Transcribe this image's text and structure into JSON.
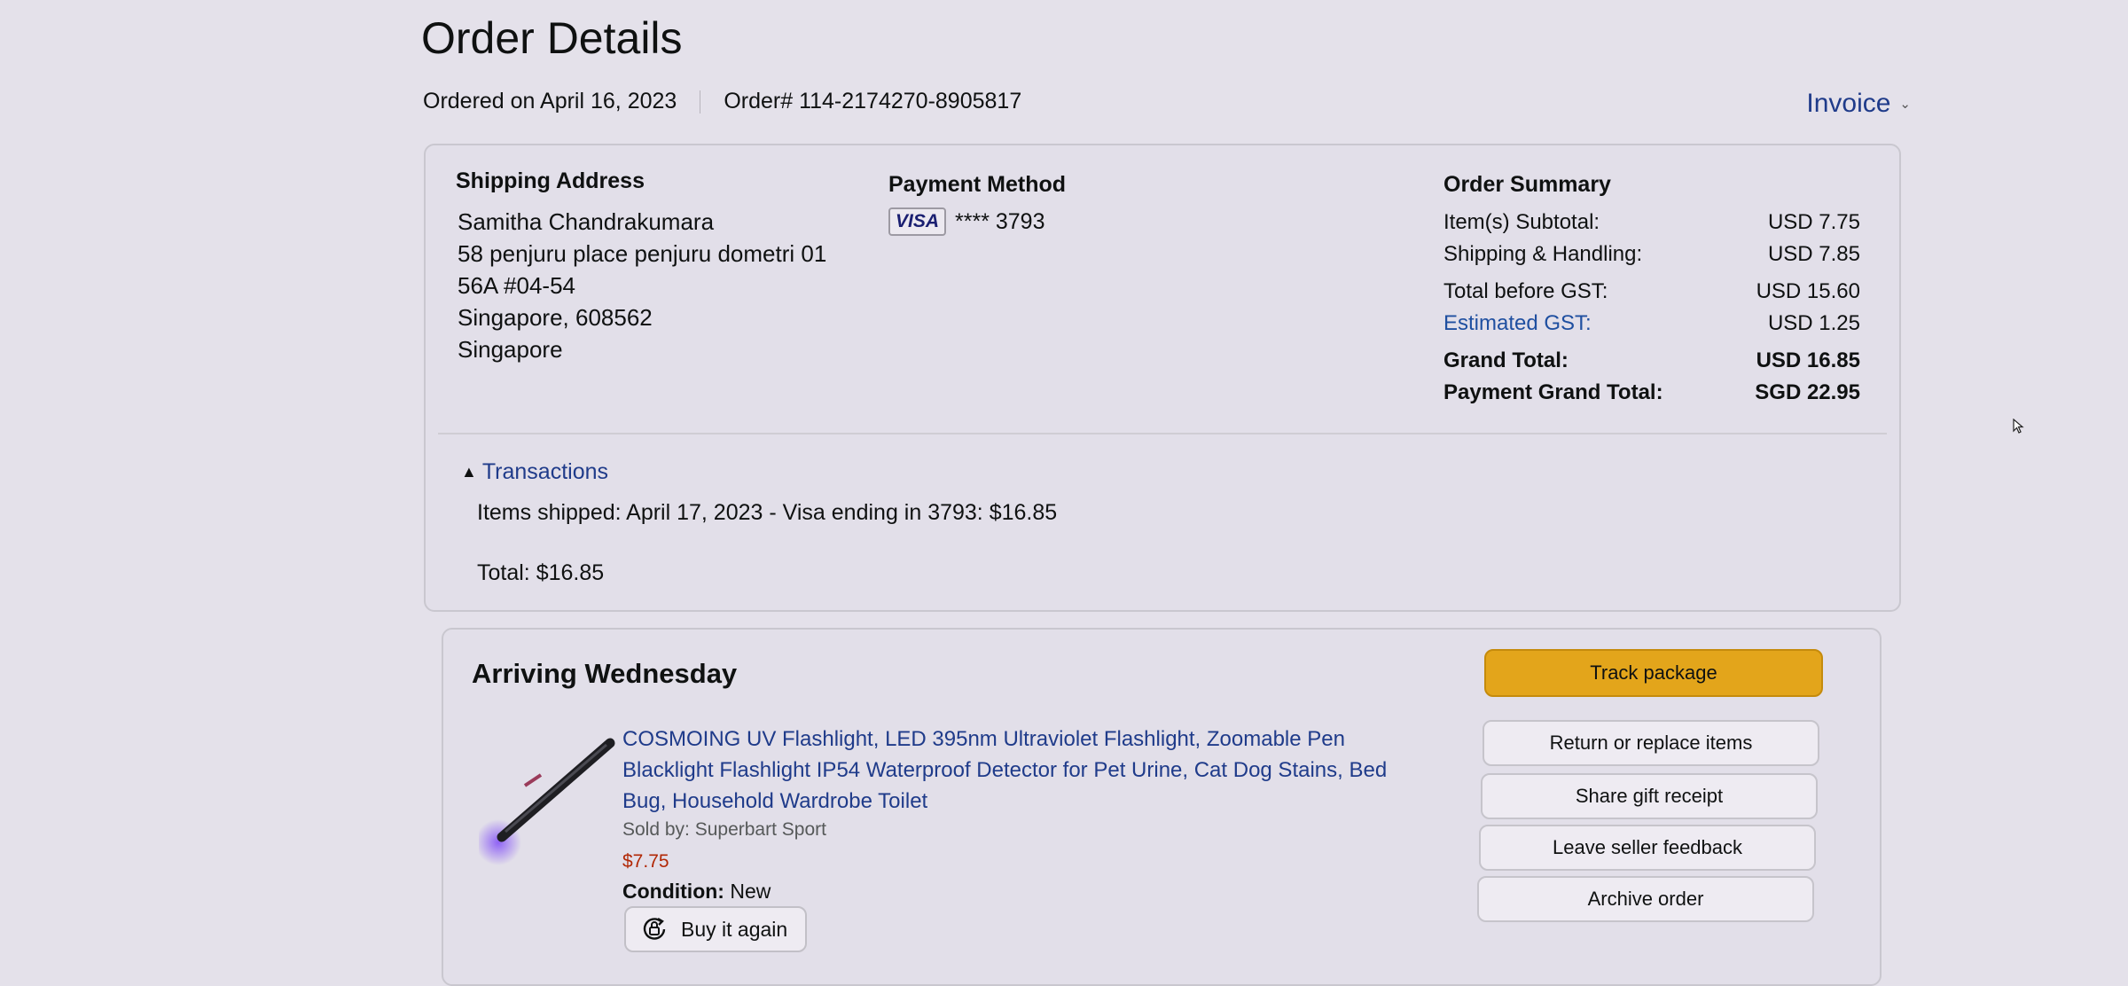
{
  "header": {
    "title": "Order Details",
    "ordered_on": "Ordered on April 16, 2023",
    "order_number": "Order# 114-2174270-8905817",
    "invoice_label": "Invoice"
  },
  "shipping": {
    "label": "Shipping Address",
    "lines": [
      "Samitha Chandrakumara",
      "58 penjuru place penjuru dometri 01",
      "56A #04-54",
      "Singapore, 608562",
      "Singapore"
    ]
  },
  "payment": {
    "label": "Payment Method",
    "card_brand": "VISA",
    "card_number": "**** 3793"
  },
  "summary": {
    "label": "Order Summary",
    "rows": [
      {
        "label": "Item(s) Subtotal:",
        "value": "USD 7.75"
      },
      {
        "label": "Shipping & Handling:",
        "value": "USD 7.85"
      },
      {
        "label": "Total before GST:",
        "value": "USD 15.60"
      },
      {
        "label": "Estimated GST:",
        "value": "USD 1.25"
      },
      {
        "label": "Grand Total:",
        "value": "USD 16.85"
      },
      {
        "label": "Payment Grand Total:",
        "value": "SGD 22.95"
      }
    ]
  },
  "transactions": {
    "toggle_label": "Transactions",
    "line": "Items shipped: April 17, 2023 - Visa ending in 3793: $16.85",
    "total": "Total: $16.85"
  },
  "shipment": {
    "status": "Arriving Wednesday",
    "item": {
      "title": "COSMOING UV Flashlight, LED 395nm Ultraviolet Flashlight, Zoomable Pen Blacklight Flashlight IP54 Waterproof Detector for Pet Urine, Cat Dog Stains, Bed Bug, Household Wardrobe Toilet",
      "sold_by": "Sold by: Superbart Sport",
      "price": "$7.75",
      "condition_label": "Condition:",
      "condition_value": "New",
      "buy_again_label": "Buy it again"
    },
    "actions": {
      "track": "Track package",
      "return": "Return or replace items",
      "gift": "Share gift receipt",
      "feedback": "Leave seller feedback",
      "archive": "Archive order"
    }
  },
  "colors": {
    "accent_button": "#e3a51b",
    "link": "#1f3b8a",
    "price": "#b12704"
  }
}
